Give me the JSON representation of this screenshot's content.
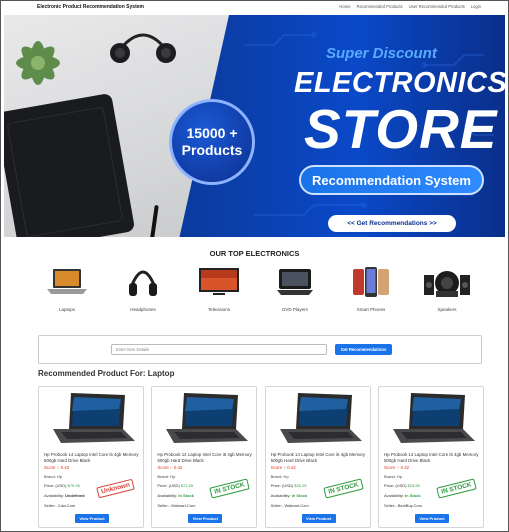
{
  "nav": {
    "brand": "Electronic Product Recommendation System",
    "links": [
      "Home",
      "Recommended Products",
      "User Recommended Products",
      "Login"
    ]
  },
  "hero": {
    "products_count": "15000 +",
    "products_label": "Products",
    "super": "Super Discount",
    "title1": "ELECTRONICS",
    "title2": "STORE",
    "pill": "Recommendation System",
    "button": "<< Get Recommendations >>"
  },
  "top_electronics": {
    "title": "OUR TOP ELECTRONICS",
    "items": [
      {
        "label": "Laptops",
        "icon": "laptop-icon"
      },
      {
        "label": "Headphones",
        "icon": "headphones-icon"
      },
      {
        "label": "Televisions",
        "icon": "television-icon"
      },
      {
        "label": "DVD Players",
        "icon": "dvd-player-icon"
      },
      {
        "label": "Smart Phones",
        "icon": "smartphone-icon"
      },
      {
        "label": "Speakers",
        "icon": "speakers-icon"
      }
    ]
  },
  "search": {
    "placeholder": "Enter Item Details",
    "button": "Get Recommendations"
  },
  "recommended": {
    "title": "Recommended Product For: Laptop",
    "products": [
      {
        "name": "Hp Probook 14 Laptop Intel Core i5 4gb Memory 500gb Hard Drive Black",
        "score": "Score :- 0.42",
        "brand": "Brand: Hp",
        "price_label": "Price: (USD) ",
        "price": "$79.95",
        "avail_label": "Availability: ",
        "availability": "Undefined",
        "seller": "Seller:- Cdw.Com",
        "stamp": "Unknown",
        "stamp_color": "#d6453a",
        "button": "View Product"
      },
      {
        "name": "Hp Probook 14 Laptop Intel Core i5 4gb Memory 500gb Hard Drive Black",
        "score": "Score :- 0.42",
        "brand": "Brand: Hp",
        "price_label": "Price: (USD) ",
        "price": "$71.05",
        "avail_label": "Availability: ",
        "availability": "In Stock",
        "seller": "Seller:- Walmart.Com",
        "stamp": "IN STOCK",
        "stamp_color": "#2e9b3d",
        "button": "View Product"
      },
      {
        "name": "Hp Probook 14 Laptop Intel Core i5 4gb Memory 500gb Hard Drive Black",
        "score": "Score :- 0.42",
        "brand": "Brand: Hp",
        "price_label": "Price: (USD) ",
        "price": "$25.25",
        "avail_label": "Availability: ",
        "availability": "In Stock",
        "seller": "Seller:- Walmart.Com",
        "stamp": "IN STOCK",
        "stamp_color": "#2e9b3d",
        "button": "View Product"
      },
      {
        "name": "Hp Probook 14 Laptop Intel Core i5 4gb Memory 500gb Hard Drive Black",
        "score": "Score :- 0.42",
        "brand": "Brand: Hp",
        "price_label": "Price: (USD) ",
        "price": "$15.55",
        "avail_label": "Availability: ",
        "availability": "In Stock",
        "seller": "Seller:- BestBuy.Com",
        "stamp": "IN STOCK",
        "stamp_color": "#2e9b3d",
        "button": "View Product"
      }
    ]
  }
}
